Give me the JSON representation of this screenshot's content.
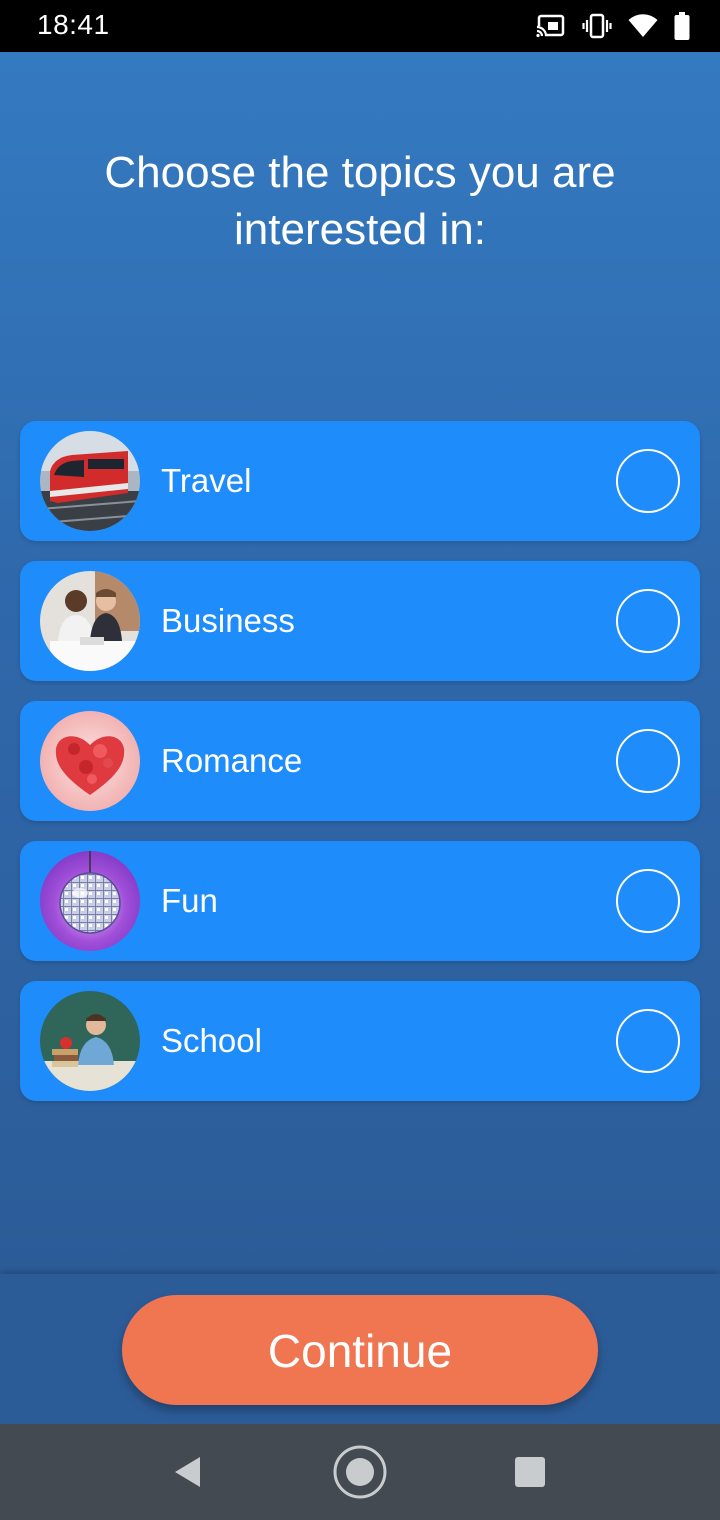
{
  "status_bar": {
    "time": "18:41",
    "icons": [
      "cast-icon",
      "vibrate-icon",
      "wifi-icon",
      "battery-icon"
    ]
  },
  "page": {
    "title": "Choose the topics you are interested in:"
  },
  "topics": [
    {
      "label": "Travel",
      "image": "train-image",
      "selected": false
    },
    {
      "label": "Business",
      "image": "business-meeting-image",
      "selected": false
    },
    {
      "label": "Romance",
      "image": "rose-petal-heart-image",
      "selected": false
    },
    {
      "label": "Fun",
      "image": "disco-ball-image",
      "selected": false
    },
    {
      "label": "School",
      "image": "teacher-image",
      "selected": false
    }
  ],
  "actions": {
    "continue_label": "Continue"
  },
  "nav_bar": {
    "icons": [
      "back-icon",
      "home-icon",
      "recents-icon"
    ]
  },
  "colors": {
    "card": "#1e8cfa",
    "background_top": "#347ac1",
    "background_bottom": "#2c5c98",
    "continue_button": "#f07652",
    "status_bar": "#000000",
    "nav_bar": "#434a51"
  }
}
